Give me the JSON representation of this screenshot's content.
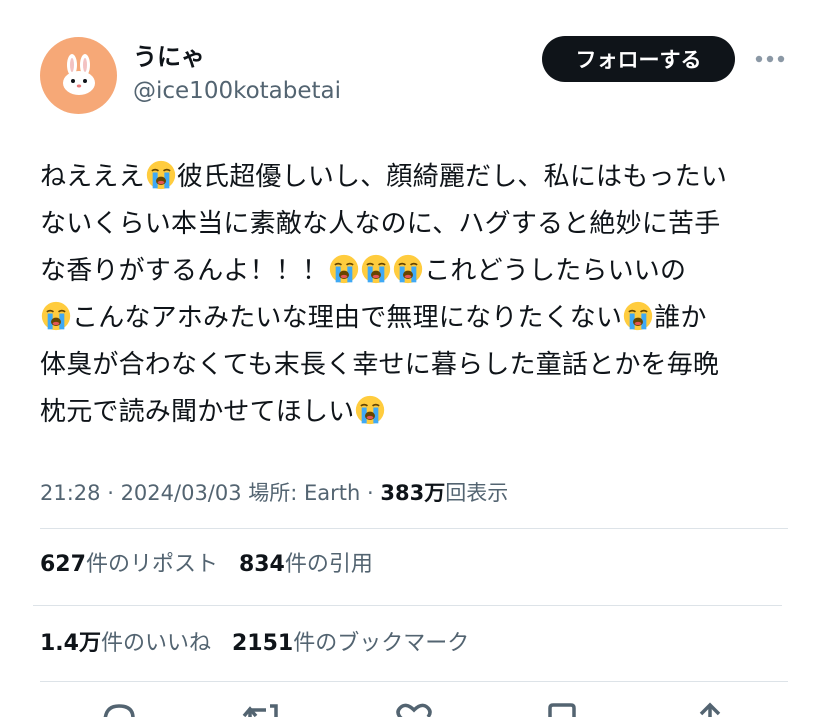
{
  "author": {
    "display_name": "うにゃ",
    "handle": "@ice100kotabetai",
    "avatar_icon": "rabbit-icon",
    "avatar_color": "#f6a877"
  },
  "actions": {
    "follow_label": "フォローする",
    "more_icon": "more-dots-icon"
  },
  "tweet": {
    "lines": [
      {
        "segments": [
          "ねえええ",
          "彼氏超優しいし、顔綺麗だし、私にはもったい"
        ]
      },
      {
        "segments": [
          "ないくらい本当に素敵な人なのに、ハグすると絶妙に苦手"
        ]
      },
      {
        "segments": [
          "な香りがするんよ！！！",
          "",
          "",
          "これどうしたらいいの"
        ]
      },
      {
        "segments": [
          "",
          "こんなアホみたいな理由で無理になりたくない",
          "誰か"
        ]
      },
      {
        "segments": [
          "体臭が合わなくても末長く幸せに暮らした童話とかを毎晩"
        ]
      },
      {
        "segments": [
          "枕元で読み聞かせてほしい",
          ""
        ]
      }
    ],
    "emoji_name": "loudly-crying-face-emoji"
  },
  "meta": {
    "time": "21:28",
    "sep1": " · ",
    "date": "2024/03/03",
    "location": " 場所: Earth",
    "sep2": " · ",
    "views_count": "383万",
    "views_label": "回表示"
  },
  "stats": {
    "reposts_count": "627",
    "reposts_label": "件のリポスト",
    "quotes_count": "834",
    "quotes_label": "件の引用",
    "likes_count": "1.4万",
    "likes_label": "件のいいね",
    "bookmarks_count": "2151",
    "bookmarks_label": "件のブックマーク"
  },
  "action_bar": {
    "icons": [
      "reply-icon",
      "retweet-icon",
      "like-icon",
      "bookmark-icon",
      "share-icon"
    ]
  },
  "colors": {
    "text": "#0f1419",
    "secondary": "#536471",
    "divider": "#dde3e8",
    "button_bg": "#0f1419",
    "emoji_face": "#ffcc3e",
    "emoji_tears": "#3fa9f5"
  }
}
